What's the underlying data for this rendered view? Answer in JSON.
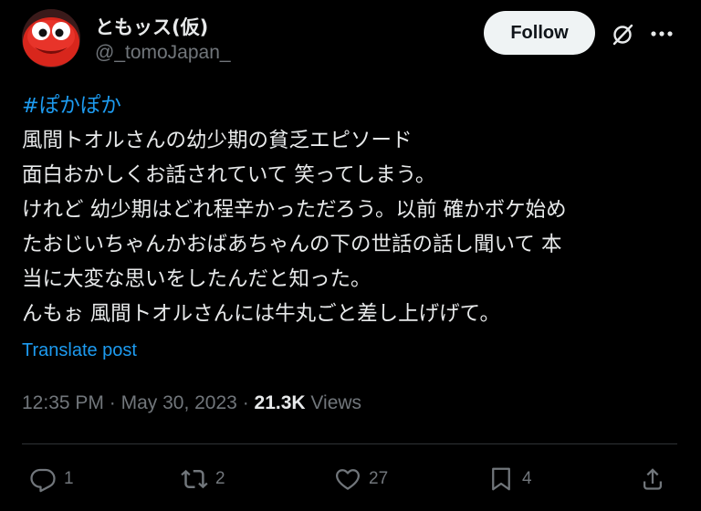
{
  "author": {
    "display_name": "ともッス(仮)",
    "handle": "@_tomoJapan_",
    "avatar_icon": "red-creature-avatar"
  },
  "header": {
    "follow_label": "Follow",
    "grok_icon": "grok-icon",
    "more_icon": "more-icon"
  },
  "post": {
    "hashtag": "#ぽかぽか",
    "lines": [
      "風間トオルさんの幼少期の貧乏エピソード",
      "面白おかしくお話されていて 笑ってしまう。",
      "けれど 幼少期はどれ程辛かっただろう。以前 確かボケ始め",
      "たおじいちゃんかおばあちゃんの下の世話の話し聞いて 本",
      "当に大変な思いをしたんだと知った。",
      "んもぉ 風間トオルさんには牛丸ごと差し上げげて。"
    ],
    "translate_label": "Translate post"
  },
  "meta": {
    "time": "12:35 PM",
    "separator": "·",
    "date": "May 30, 2023",
    "views_count": "21.3K",
    "views_label": "Views"
  },
  "actions": {
    "reply_count": "1",
    "repost_count": "2",
    "like_count": "27",
    "bookmark_count": "4"
  },
  "colors": {
    "background": "#000000",
    "text_primary": "#e7e9ea",
    "text_secondary": "#71767b",
    "link": "#1d9bf0",
    "divider": "#2f3336",
    "follow_button_bg": "#eff3f4"
  }
}
